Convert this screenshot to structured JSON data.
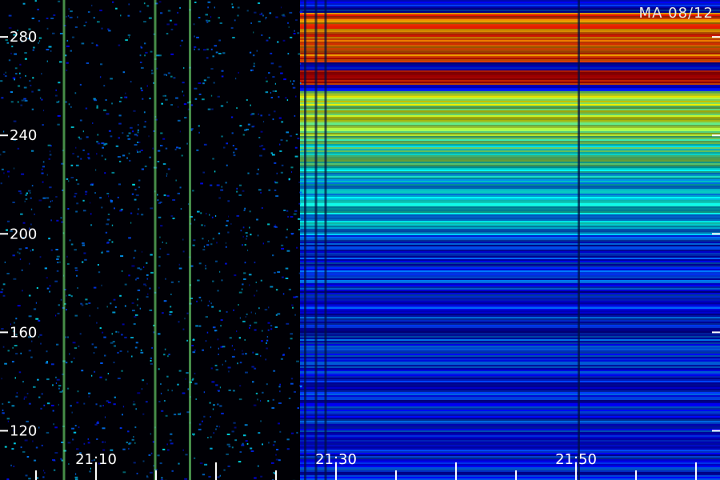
{
  "chart_data": {
    "type": "heatmap",
    "title": "MA 08/12",
    "xlabel": "",
    "ylabel": "",
    "x_ticks": [
      "21:10",
      "21:30",
      "21:50"
    ],
    "y_ticks": [
      120,
      160,
      200,
      240,
      280
    ],
    "x_range": [
      "21:02",
      "22:02"
    ],
    "y_range": [
      100,
      295
    ],
    "colormap": "jet",
    "activity_start": "21:27",
    "bands": [
      {
        "from": 270,
        "to": 290,
        "level": 0.78
      },
      {
        "from": 261,
        "to": 267,
        "level": 0.88
      },
      {
        "from": 240,
        "to": 258,
        "level": 0.55
      },
      {
        "from": 225,
        "to": 240,
        "level": 0.45
      },
      {
        "from": 200,
        "to": 225,
        "level": 0.32
      },
      {
        "from": 100,
        "to": 200,
        "level": 0.16
      }
    ],
    "grid": false
  },
  "labels": {
    "corner": "MA 08/12"
  }
}
